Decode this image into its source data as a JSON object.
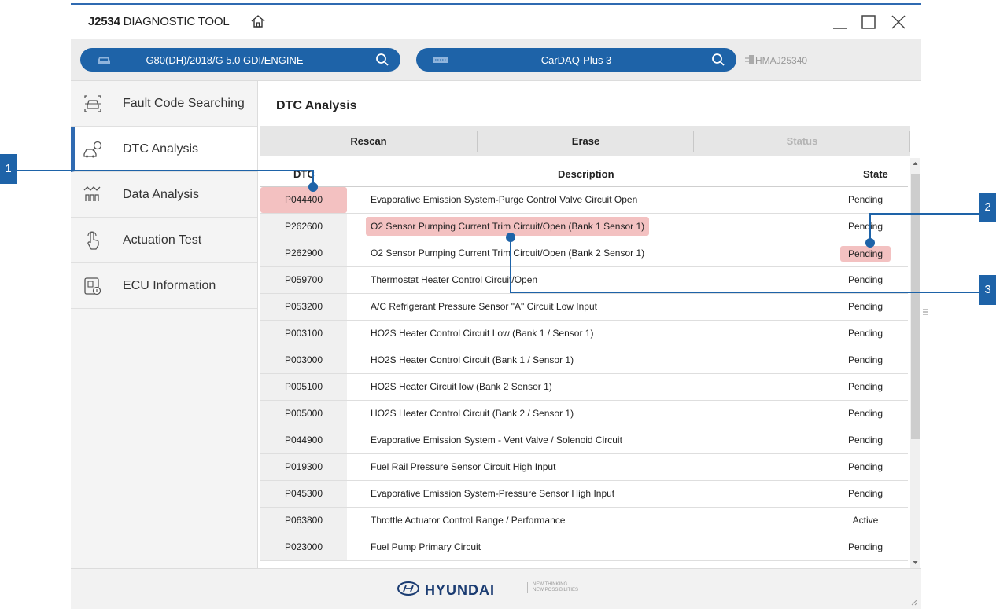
{
  "app": {
    "title_bold": "J2534",
    "title_rest": " DIAGNOSTIC TOOL"
  },
  "toolbar": {
    "vehicle": "G80(DH)/2018/G 5.0 GDI/ENGINE",
    "device": "CarDAQ-Plus 3",
    "device_id": "HMAJ25340"
  },
  "sidebar": {
    "items": [
      {
        "label": "Fault Code Searching",
        "icon": "car-scan-icon"
      },
      {
        "label": "DTC Analysis",
        "icon": "car-wrench-icon"
      },
      {
        "label": "Data Analysis",
        "icon": "waveform-icon"
      },
      {
        "label": "Actuation Test",
        "icon": "hand-tap-icon"
      },
      {
        "label": "ECU Information",
        "icon": "ecu-info-icon"
      }
    ],
    "active_index": 1
  },
  "main": {
    "title": "DTC Analysis",
    "actions": {
      "rescan": "Rescan",
      "erase": "Erase",
      "status": "Status"
    },
    "columns": {
      "dtc": "DTC",
      "description": "Description",
      "state": "State"
    },
    "rows": [
      {
        "code": "P044400",
        "description": "Evaporative Emission System-Purge Control Valve Circuit Open",
        "state": "Pending"
      },
      {
        "code": "P262600",
        "description": "O2 Sensor Pumping Current Trim Circuit/Open (Bank 1 Sensor 1)",
        "state": "Pending"
      },
      {
        "code": "P262900",
        "description": "O2 Sensor Pumping Current Trim Circuit/Open (Bank 2 Sensor 1)",
        "state": "Pending"
      },
      {
        "code": "P059700",
        "description": "Thermostat Heater Control Circuit/Open",
        "state": "Pending"
      },
      {
        "code": "P053200",
        "description": "A/C Refrigerant Pressure Sensor \"A\" Circuit Low Input",
        "state": "Pending"
      },
      {
        "code": "P003100",
        "description": "HO2S Heater Control Circuit Low (Bank 1 / Sensor 1)",
        "state": "Pending"
      },
      {
        "code": "P003000",
        "description": "HO2S Heater Control Circuit (Bank 1 / Sensor 1)",
        "state": "Pending"
      },
      {
        "code": "P005100",
        "description": "HO2S Heater Circuit low (Bank 2  Sensor 1)",
        "state": "Pending"
      },
      {
        "code": "P005000",
        "description": "HO2S Heater Control Circuit (Bank 2 / Sensor 1)",
        "state": "Pending"
      },
      {
        "code": "P044900",
        "description": "Evaporative Emission System - Vent Valve / Solenoid Circuit",
        "state": "Pending"
      },
      {
        "code": "P019300",
        "description": "Fuel Rail Pressure Sensor Circuit High Input",
        "state": "Pending"
      },
      {
        "code": "P045300",
        "description": "Evaporative Emission System-Pressure Sensor High Input",
        "state": "Pending"
      },
      {
        "code": "P063800",
        "description": "Throttle Actuator Control Range / Performance",
        "state": "Active"
      },
      {
        "code": "P023000",
        "description": "Fuel Pump Primary Circuit",
        "state": "Pending"
      }
    ]
  },
  "footer": {
    "brand": "HYUNDAI",
    "tagline_1": "NEW THINKING",
    "tagline_2": "NEW POSSIBILITIES"
  },
  "callouts": [
    "1",
    "2",
    "3"
  ],
  "colors": {
    "accent": "#1e63a8",
    "highlight": "#f3c1c1"
  }
}
